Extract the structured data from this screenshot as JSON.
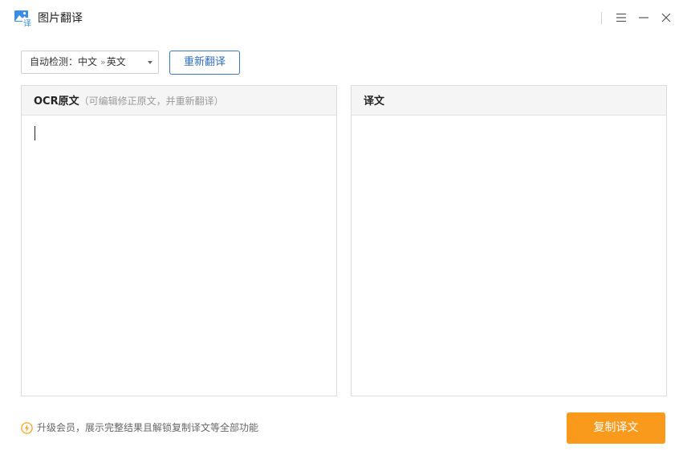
{
  "window": {
    "title": "图片翻译",
    "icon": "image-translate-icon"
  },
  "toolbar": {
    "language": {
      "source_prefix": "自动检测：",
      "source_lang": "中文",
      "arrow": "»",
      "target_lang": "英文"
    },
    "retranslate_label": "重新翻译"
  },
  "source_panel": {
    "title": "OCR原文",
    "hint": "（可编辑修正原文，并重新翻译）",
    "value": ""
  },
  "result_panel": {
    "title": "译文",
    "value": ""
  },
  "footer": {
    "vip_text": "升级会员，展示完整结果且解锁复制译文等全部功能",
    "copy_label": "复制译文"
  },
  "colors": {
    "accent_blue": "#3a79c6",
    "copy_button": "#f99a1c",
    "vip_icon": "#f5a623"
  }
}
